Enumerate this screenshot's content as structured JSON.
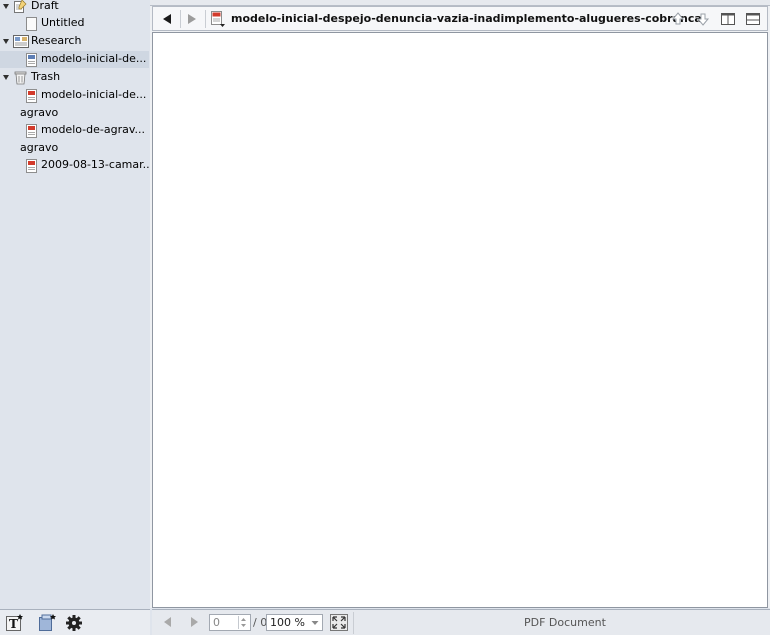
{
  "binder": {
    "items": [
      {
        "label": "Draft",
        "icon": "draft-folder-icon"
      },
      {
        "label": "Untitled",
        "icon": "page-icon"
      },
      {
        "label": "Research",
        "icon": "research-folder-icon"
      },
      {
        "label": "modelo-inicial-de...",
        "icon": "pdf-icon"
      },
      {
        "label": "Trash",
        "icon": "trash-icon"
      },
      {
        "label": "modelo-inicial-de...",
        "icon": "pdf-icon"
      },
      {
        "label": "agravo"
      },
      {
        "label": "modelo-de-agrav...",
        "icon": "pdf-icon"
      },
      {
        "label": "agravo"
      },
      {
        "label": "2009-08-13-camar...",
        "icon": "pdf-icon"
      }
    ]
  },
  "editor": {
    "title": "modelo-inicial-despejo-denuncia-vazia-inadimplemento-alugueres-cobranca"
  },
  "footer": {
    "page_value": "0",
    "page_total": "/ 0",
    "zoom_value": "100 %",
    "status": "PDF Document"
  },
  "colors": {
    "sidebar_bg": "#dfe4ec",
    "selected_bg": "#cfd7e2",
    "pdf_red": "#d23a2b"
  }
}
